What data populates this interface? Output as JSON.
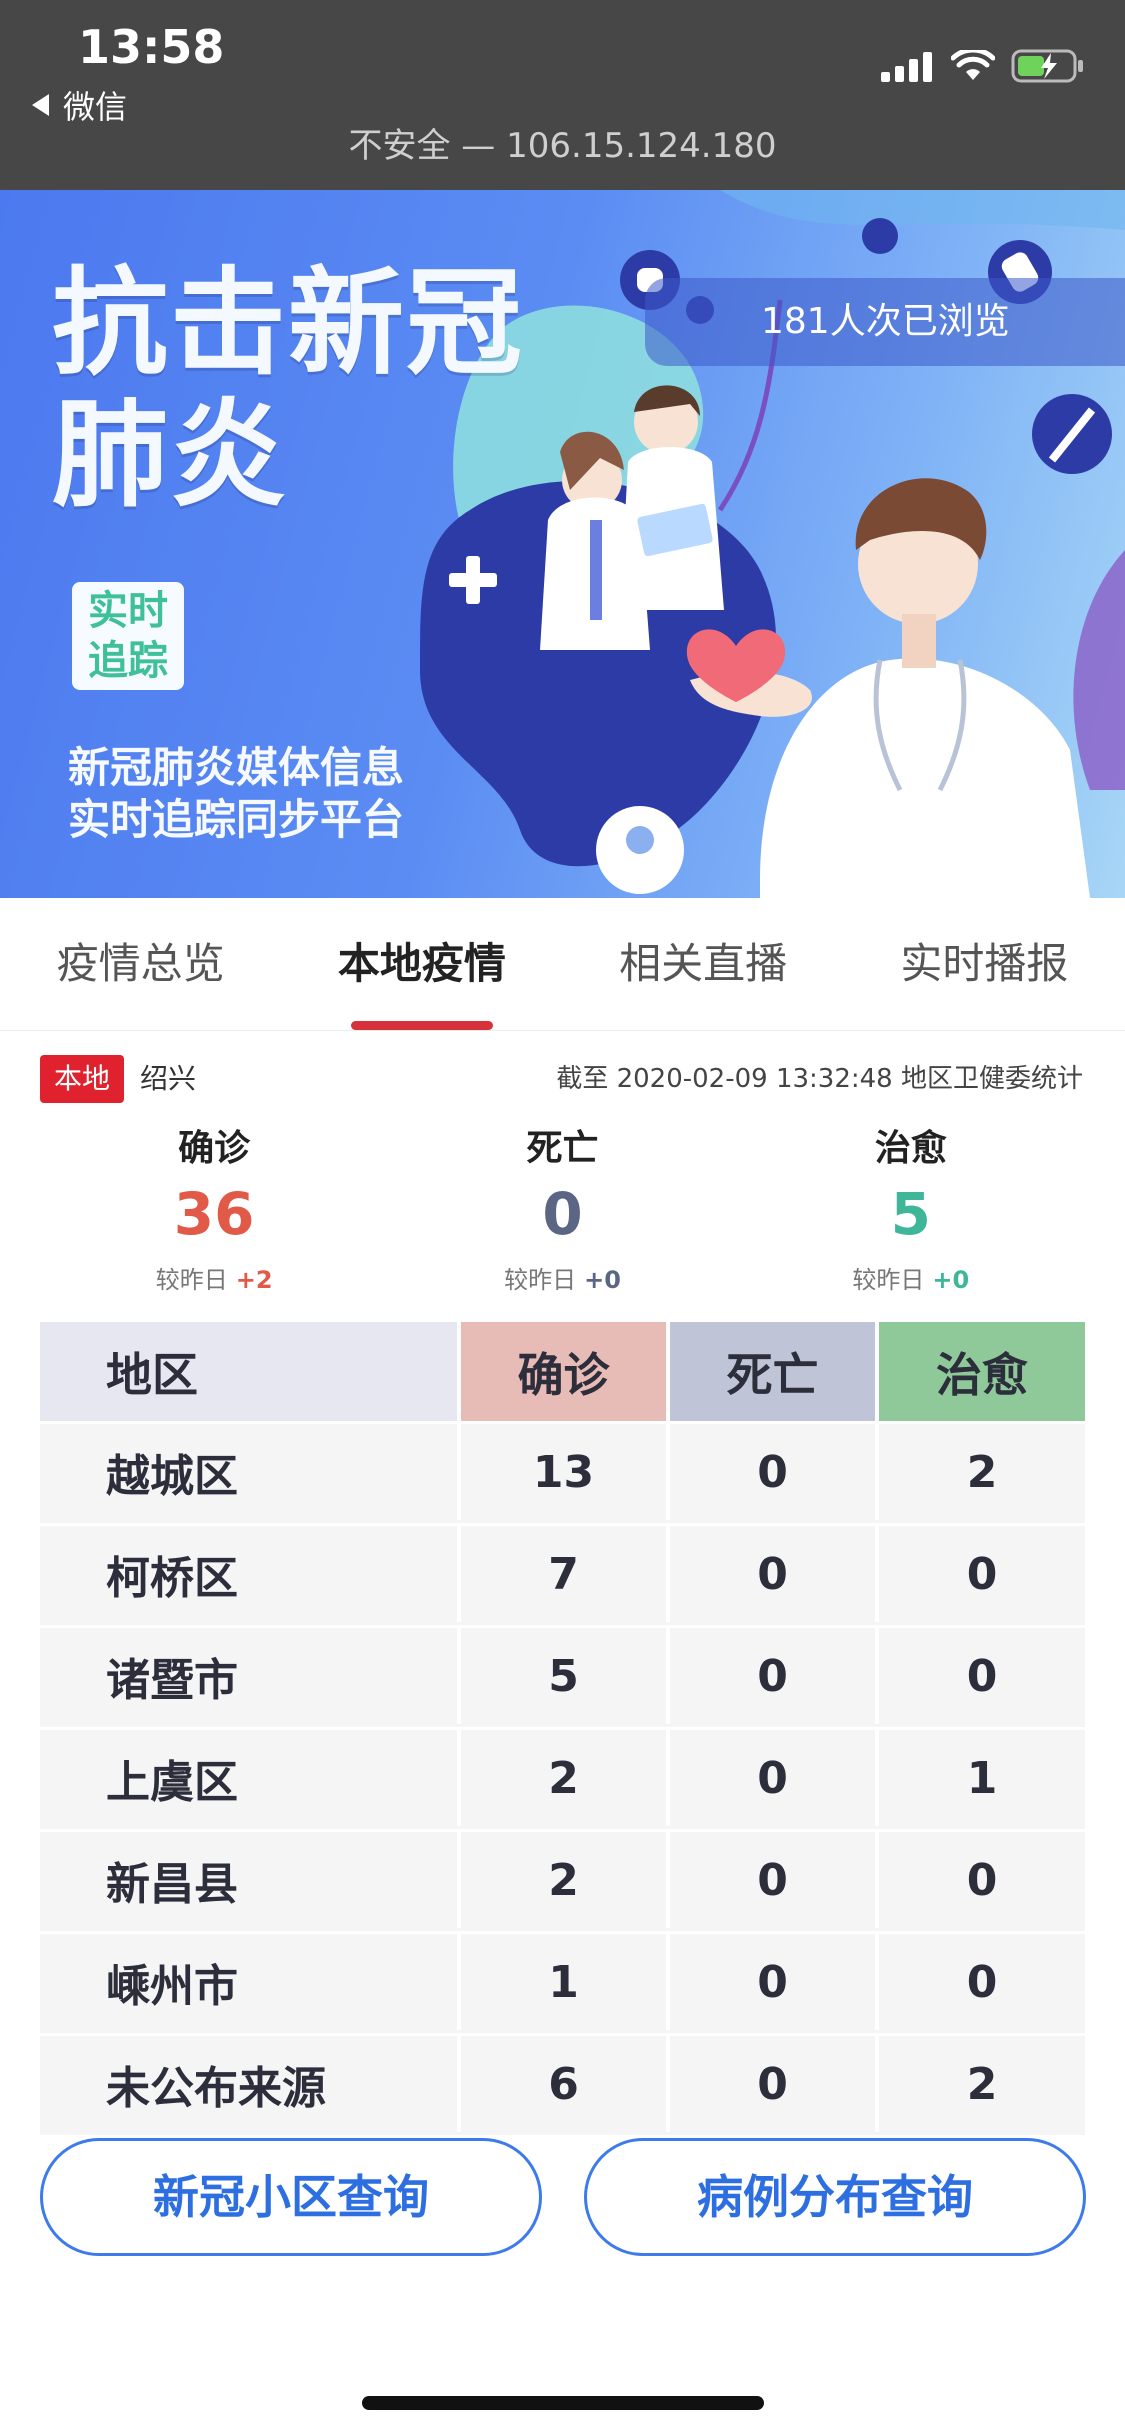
{
  "status_bar": {
    "time": "13:58",
    "back_label": "微信",
    "url": "不安全 — 106.15.124.180",
    "icons": [
      "signal-icon",
      "wifi-icon",
      "battery-charging-icon"
    ]
  },
  "banner": {
    "title_line1": "抗击新冠",
    "title_line2": "肺炎",
    "tag_line1": "实时",
    "tag_line2": "追踪",
    "subtitle_line1": "新冠肺炎媒体信息",
    "subtitle_line2": "实时追踪同步平台",
    "views": "181人次已浏览"
  },
  "tabs": [
    {
      "label": "疫情总览",
      "active": false
    },
    {
      "label": "本地疫情",
      "active": true
    },
    {
      "label": "相关直播",
      "active": false
    },
    {
      "label": "实时播报",
      "active": false
    }
  ],
  "info": {
    "badge": "本地",
    "city": "绍兴",
    "as_of": "截至 2020-02-09 13:32:48 地区卫健委统计"
  },
  "summary": {
    "confirmed": {
      "label": "确诊",
      "value": "36",
      "change_label": "较昨日",
      "change": "+2",
      "color": "#e05a47"
    },
    "deaths": {
      "label": "死亡",
      "value": "0",
      "change_label": "较昨日",
      "change": "+0",
      "color": "#5b6684"
    },
    "cured": {
      "label": "治愈",
      "value": "5",
      "change_label": "较昨日",
      "change": "+0",
      "color": "#3fb59a"
    }
  },
  "table": {
    "headers": [
      "地区",
      "确诊",
      "死亡",
      "治愈"
    ],
    "rows": [
      [
        "越城区",
        "13",
        "0",
        "2"
      ],
      [
        "柯桥区",
        "7",
        "0",
        "0"
      ],
      [
        "诸暨市",
        "5",
        "0",
        "0"
      ],
      [
        "上虞区",
        "2",
        "0",
        "1"
      ],
      [
        "新昌县",
        "2",
        "0",
        "0"
      ],
      [
        "嵊州市",
        "1",
        "0",
        "0"
      ],
      [
        "未公布来源",
        "6",
        "0",
        "2"
      ]
    ]
  },
  "buttons": {
    "community_query": "新冠小区查询",
    "case_distribution_query": "病例分布查询"
  },
  "colors": {
    "accent_red": "#d7323c",
    "button_blue": "#2d6fe0"
  }
}
